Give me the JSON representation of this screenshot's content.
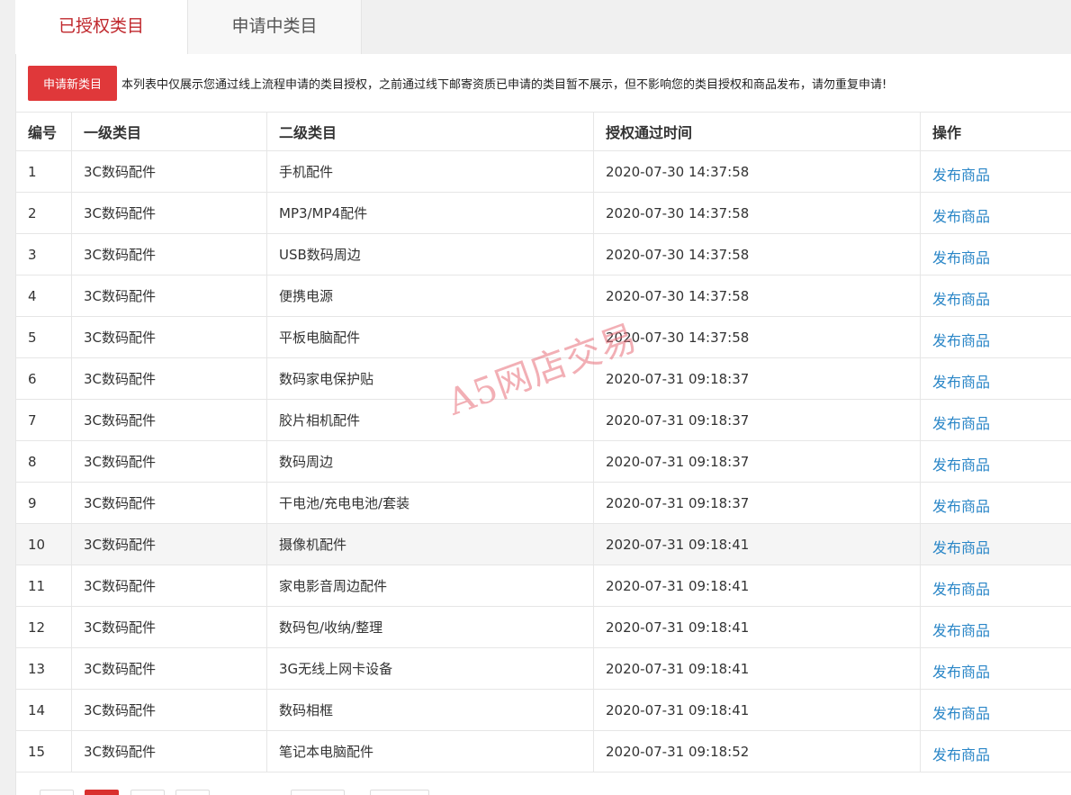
{
  "tabs": [
    {
      "label": "已授权类目",
      "active": true
    },
    {
      "label": "申请中类目",
      "active": false
    }
  ],
  "notice": {
    "apply_button": "申请新类目",
    "text": "本列表中仅展示您通过线上流程申请的类目授权，之前通过线下邮寄资质已申请的类目暂不展示，但不影响您的类目授权和商品发布，请勿重复申请!"
  },
  "table": {
    "headers": [
      "编号",
      "一级类目",
      "二级类目",
      "授权通过时间",
      "操作"
    ],
    "rows": [
      {
        "id": "1",
        "level1": "3C数码配件",
        "level2": "手机配件",
        "time": "2020-07-30 14:37:58",
        "action": "发布商品"
      },
      {
        "id": "2",
        "level1": "3C数码配件",
        "level2": "MP3/MP4配件",
        "time": "2020-07-30 14:37:58",
        "action": "发布商品"
      },
      {
        "id": "3",
        "level1": "3C数码配件",
        "level2": "USB数码周边",
        "time": "2020-07-30 14:37:58",
        "action": "发布商品"
      },
      {
        "id": "4",
        "level1": "3C数码配件",
        "level2": "便携电源",
        "time": "2020-07-30 14:37:58",
        "action": "发布商品"
      },
      {
        "id": "5",
        "level1": "3C数码配件",
        "level2": "平板电脑配件",
        "time": "2020-07-30 14:37:58",
        "action": "发布商品"
      },
      {
        "id": "6",
        "level1": "3C数码配件",
        "level2": "数码家电保护贴",
        "time": "2020-07-31 09:18:37",
        "action": "发布商品"
      },
      {
        "id": "7",
        "level1": "3C数码配件",
        "level2": "胶片相机配件",
        "time": "2020-07-31 09:18:37",
        "action": "发布商品"
      },
      {
        "id": "8",
        "level1": "3C数码配件",
        "level2": "数码周边",
        "time": "2020-07-31 09:18:37",
        "action": "发布商品"
      },
      {
        "id": "9",
        "level1": "3C数码配件",
        "level2": "干电池/充电电池/套装",
        "time": "2020-07-31 09:18:37",
        "action": "发布商品"
      },
      {
        "id": "10",
        "level1": "3C数码配件",
        "level2": "摄像机配件",
        "time": "2020-07-31 09:18:41",
        "action": "发布商品"
      },
      {
        "id": "11",
        "level1": "3C数码配件",
        "level2": "家电影音周边配件",
        "time": "2020-07-31 09:18:41",
        "action": "发布商品"
      },
      {
        "id": "12",
        "level1": "3C数码配件",
        "level2": "数码包/收纳/整理",
        "time": "2020-07-31 09:18:41",
        "action": "发布商品"
      },
      {
        "id": "13",
        "level1": "3C数码配件",
        "level2": "3G无线上网卡设备",
        "time": "2020-07-31 09:18:41",
        "action": "发布商品"
      },
      {
        "id": "14",
        "level1": "3C数码配件",
        "level2": "数码相框",
        "time": "2020-07-31 09:18:41",
        "action": "发布商品"
      },
      {
        "id": "15",
        "level1": "3C数码配件",
        "level2": "笔记本电脑配件",
        "time": "2020-07-31 09:18:52",
        "action": "发布商品"
      }
    ]
  },
  "watermark": "A5网店交易",
  "colors": {
    "active_tab_text": "#c0282d",
    "apply_button_bg": "#e0383a",
    "link": "#2a86c7",
    "pager_active": "#d9302e"
  }
}
